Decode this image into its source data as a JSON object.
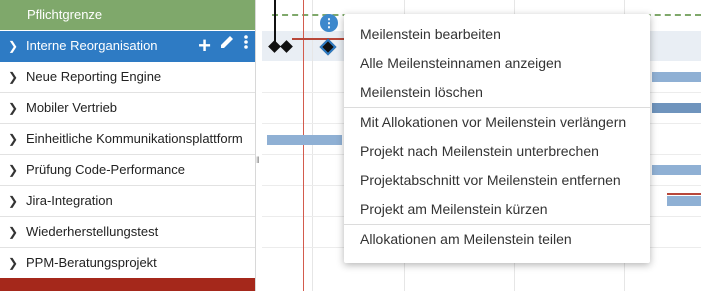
{
  "group_header": "Pflichtgrenze",
  "projects": [
    {
      "label": "Interne Reorganisation",
      "selected": true
    },
    {
      "label": "Neue Reporting Engine"
    },
    {
      "label": "Mobiler Vertrieb"
    },
    {
      "label": "Einheitliche Kommunikationsplattform"
    },
    {
      "label": "Prüfung Code-Performance"
    },
    {
      "label": "Jira-Integration"
    },
    {
      "label": "Wiederherstellungstest"
    },
    {
      "label": "PPM-Beratungsprojekt"
    }
  ],
  "row_icons": [
    "chevron-right-icon",
    "plus-icon",
    "pencil-icon",
    "more-vert-icon"
  ],
  "colors": {
    "group": "#7fa86b",
    "selected": "#2e7bc4",
    "bottom": "#a5281b",
    "bar": "#8fb0d4"
  },
  "context_menu": {
    "items": [
      "Meilenstein bearbeiten",
      "Alle Meilensteinnamen anzeigen",
      "Meilenstein löschen",
      "Mit Allokationen vor Meilenstein verlängern",
      "Projekt nach Meilenstein unterbrechen",
      "Projektabschnitt vor Meilenstein entfernen",
      "Projekt am Meilenstein kürzen",
      "Allokationen am Meilenstein teilen"
    ]
  }
}
